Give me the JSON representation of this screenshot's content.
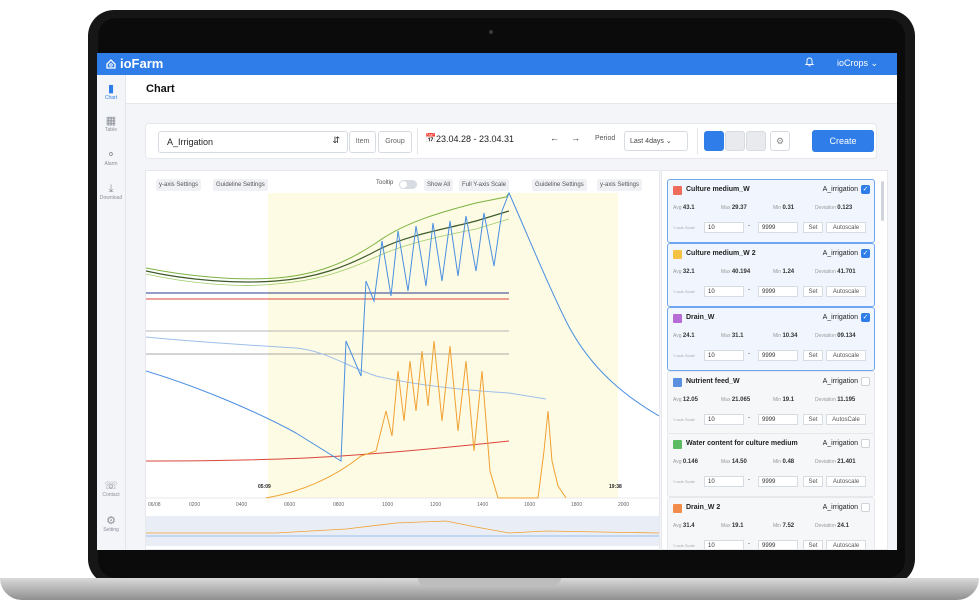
{
  "app": {
    "logo": "ioFarm",
    "user": "ioCrops"
  },
  "sidebar": {
    "items": [
      {
        "label": "Chart",
        "icon": "chart-icon"
      },
      {
        "label": "Table",
        "icon": "table-icon"
      },
      {
        "label": "Alarm",
        "icon": "alarm-icon"
      },
      {
        "label": "Download",
        "icon": "download-icon"
      },
      {
        "label": "Contact",
        "icon": "contact-icon"
      },
      {
        "label": "Setting",
        "icon": "setting-icon"
      }
    ]
  },
  "header": {
    "title": "Chart"
  },
  "toolbar": {
    "select_value": "A_Irrigation",
    "item_label": "Item",
    "group_label": "Group",
    "date_range": "23.04.28 - 23.04.31",
    "prev_arrow": "←",
    "next_arrow": "→",
    "period_label": "Period",
    "period_value": "Last 4days",
    "create_label": "Create"
  },
  "chart_header": {
    "left_y_axis_settings": "y-axis Settings",
    "left_guideline_settings": "Guideline Settings",
    "tooltip_label": "Tooltip",
    "show_all": "Show All",
    "full_y_axis_scale": "Full Y-axis Scale",
    "right_guideline_settings": "Guideline Settings",
    "right_y_axis_settings": "y-axis Settings"
  },
  "chart_data": {
    "type": "line",
    "x_ticks": [
      "06/08",
      "0200",
      "0400",
      "0600",
      "0800",
      "1000",
      "1200",
      "1400",
      "1600",
      "1800",
      "2000"
    ],
    "markers": [
      "05:09",
      "19:38"
    ],
    "series": [
      {
        "color": "#7cb342"
      },
      {
        "color": "#3d5a2b"
      },
      {
        "color": "#5b9be6"
      },
      {
        "color": "#f0a030"
      },
      {
        "color": "#9ec0ea"
      },
      {
        "color": "#d9453b"
      },
      {
        "color": "#2b3a8c"
      }
    ]
  },
  "cards": [
    {
      "name": "Culture medium_W",
      "group": "A_irrigation",
      "checked": true,
      "color": "#ef6b5a",
      "avg": "43.1",
      "max": "29.37",
      "min": "0.31",
      "deviation": "0.123",
      "from": "10",
      "to": "9999",
      "set": "Set",
      "auto": "Autoscale"
    },
    {
      "name": "Culture medium_W 2",
      "group": "A_irrigation",
      "checked": true,
      "color": "#f6c244",
      "avg": "32.1",
      "max": "40.194",
      "min": "1.24",
      "deviation": "41.701",
      "from": "10",
      "to": "9999",
      "set": "Set",
      "auto": "Autoscale"
    },
    {
      "name": "Drain_W",
      "group": "A_irrigation",
      "checked": true,
      "color": "#b76bd6",
      "avg": "24.1",
      "max": "31.1",
      "min": "10.34",
      "deviation": "09.134",
      "from": "10",
      "to": "9999",
      "set": "Set",
      "auto": "Autoscale"
    },
    {
      "name": "Nutrient feed_W",
      "group": "A_irrigation",
      "checked": false,
      "color": "#5b8fe0",
      "avg": "12.05",
      "max": "21.065",
      "min": "19.1",
      "deviation": "11.195",
      "from": "10",
      "to": "9999",
      "set": "Set",
      "auto": "AutosCale"
    },
    {
      "name": "Water content for culture medium",
      "group": "A_irrigation",
      "checked": false,
      "color": "#5dbb63",
      "avg": "0.146",
      "max": "14.50",
      "min": "0.48",
      "deviation": "21.401",
      "from": "10",
      "to": "9999",
      "set": "Set",
      "auto": "Autoscale"
    },
    {
      "name": "Drain_W 2",
      "group": "A_irrigation",
      "checked": false,
      "color": "#f28c4b",
      "avg": "31.4",
      "max": "19.1",
      "min": "7.52",
      "deviation": "24.1",
      "from": "10",
      "to": "9999",
      "set": "Set",
      "auto": "Autoscale"
    }
  ],
  "labels": {
    "avg": "Avg",
    "max": "Max",
    "min": "Min",
    "deviation": "Deviation",
    "scale": "Y-axis Scale"
  }
}
